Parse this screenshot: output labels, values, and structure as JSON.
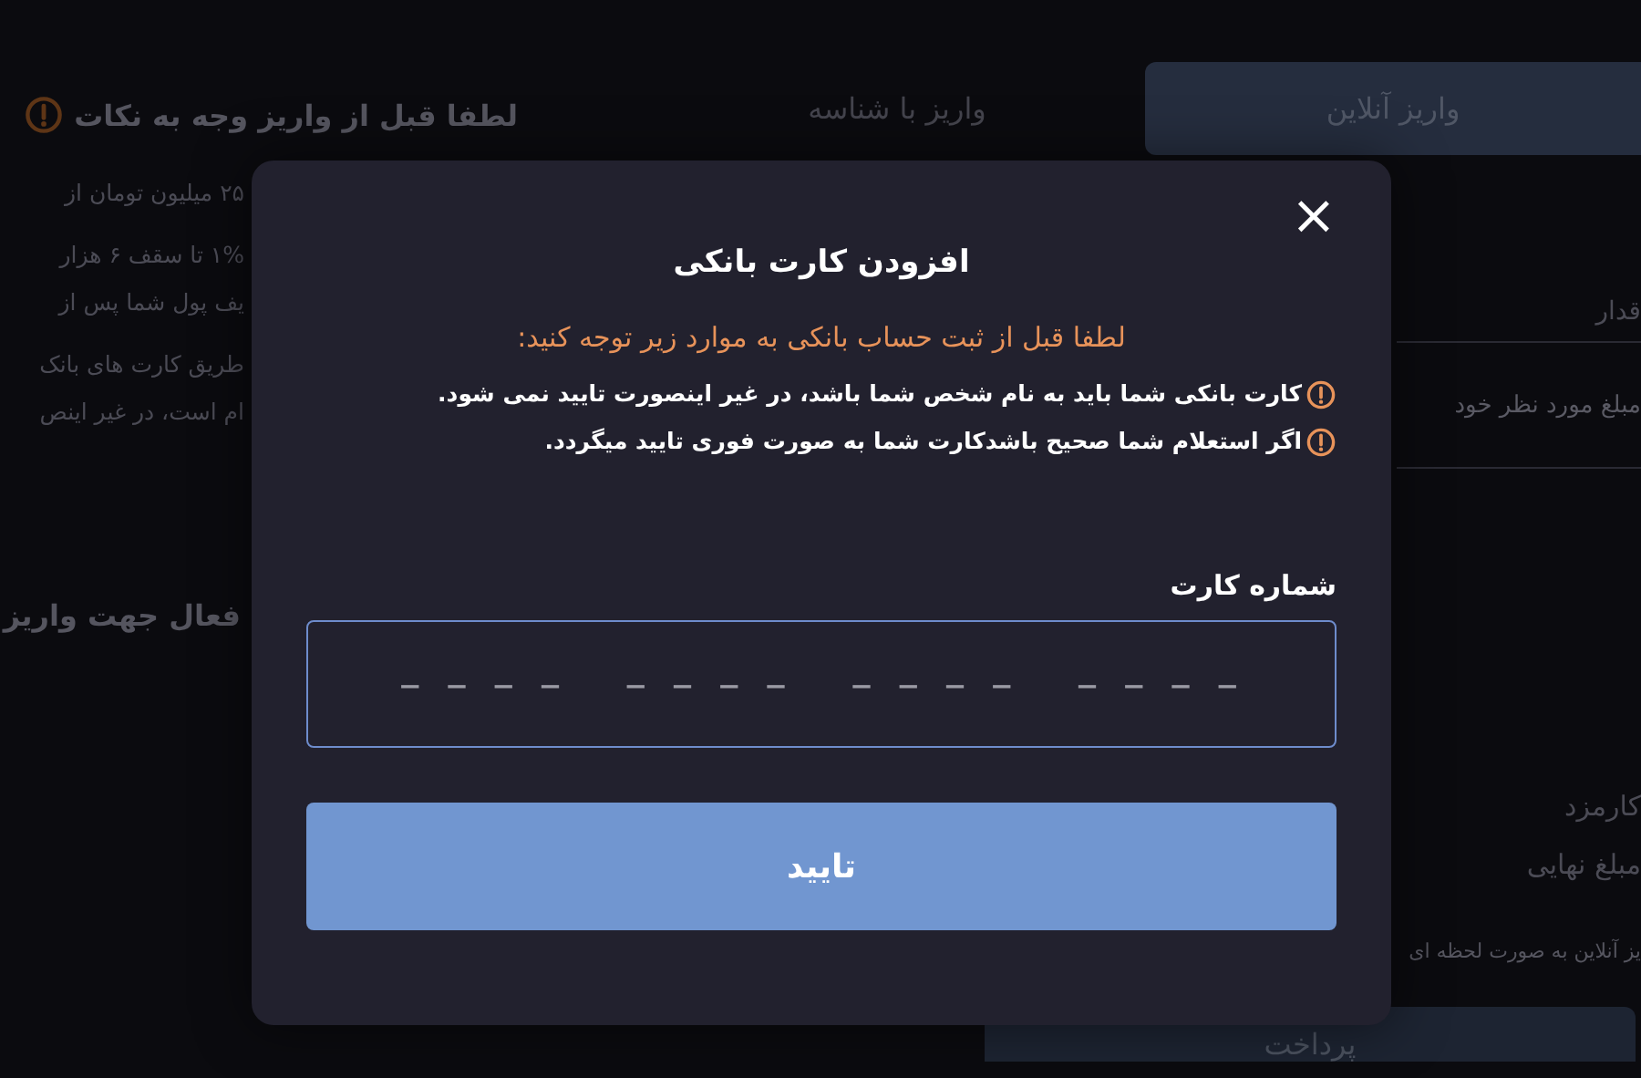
{
  "background": {
    "notice": {
      "title": "لطفا قبل از واریز وجه به نکات",
      "lines": [
        "۲۵ میلیون تومان از",
        "۱% تا سقف ۶ هزار",
        "یف پول شما پس از",
        "طریق کارت های بانک",
        "ام است، در غیر اینص"
      ]
    },
    "cards_heading": "فعال جهت واریز",
    "tabs": [
      {
        "label": "واریز آنلاین",
        "selected": true
      },
      {
        "label": "واریز با شناسه",
        "selected": false
      }
    ],
    "amount": {
      "label": "قدار",
      "placeholder": "مبلغ مورد نظر خود"
    },
    "summary": [
      "کارمزد",
      "مبلغ نهایی"
    ],
    "note": "یز آنلاین به صورت لحظه ای",
    "pay_button": "پرداخت"
  },
  "modal": {
    "close": "×",
    "title": "افزودن کارت بانکی",
    "subtitle": "لطفا قبل از ثبت حساب بانکی به موارد زیر توجه کنید:",
    "warnings": [
      "کارت بانکی شما باید به نام شخص شما باشد، در غیر اینصورت تایید نمی شود.",
      "اگر استعلام شما صحیح باشدکارت شما به صورت فوری تایید میگردد."
    ],
    "card_field": {
      "label": "شماره کارت",
      "placeholder": "– – – –   – – – –   – – – –   – – – –"
    },
    "confirm_button": "تایید"
  }
}
